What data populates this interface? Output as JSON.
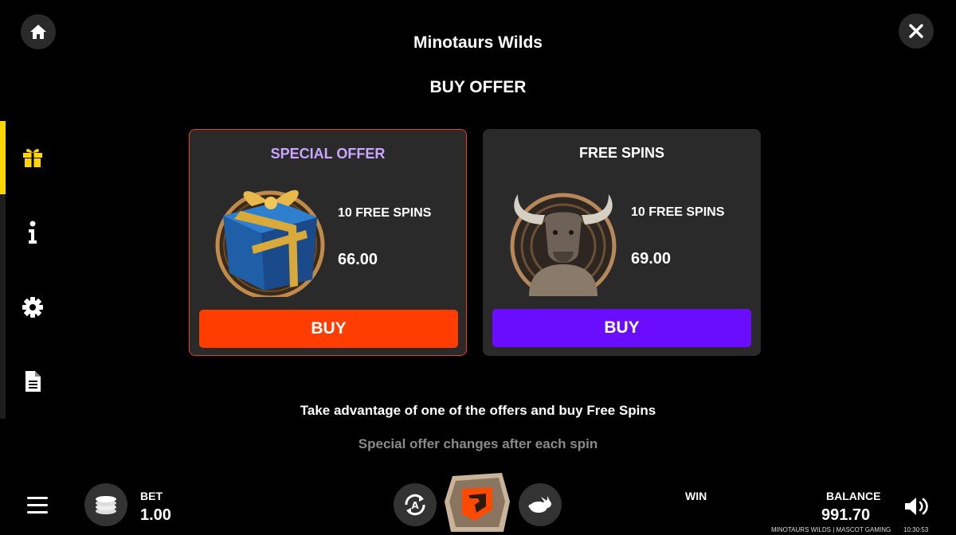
{
  "header": {
    "game_title": "Minotaurs Wilds",
    "section_title": "BUY OFFER"
  },
  "sidebar": {
    "items": [
      {
        "icon": "gift-icon",
        "active": true
      },
      {
        "icon": "info-icon",
        "active": false
      },
      {
        "icon": "gear-icon",
        "active": false
      },
      {
        "icon": "document-icon",
        "active": false
      }
    ],
    "active_color": "#ffd600"
  },
  "offers": [
    {
      "heading": "SPECIAL OFFER",
      "spins": "10 FREE SPINS",
      "price": "66.00",
      "button": "BUY",
      "emblem": "gift-box-emblem",
      "button_color": "#ff3d00",
      "heading_color": "#c9a6ff"
    },
    {
      "heading": "FREE SPINS",
      "spins": "10 FREE SPINS",
      "price": "69.00",
      "button": "BUY",
      "emblem": "minotaur-emblem",
      "button_color": "#6a0dff",
      "heading_color": "#ffffff"
    }
  ],
  "promo": {
    "line1": "Take advantage of one of the offers and buy Free Spins",
    "line2": "Special offer changes after each spin"
  },
  "bottom_bar": {
    "bet_label": "BET",
    "bet_value": "1.00",
    "win_label": "WIN",
    "balance_label": "BALANCE",
    "balance_value": "991.70",
    "brand": "MINOTAURS WILDS | MASCOT GAMING",
    "time": "10:30:53"
  }
}
